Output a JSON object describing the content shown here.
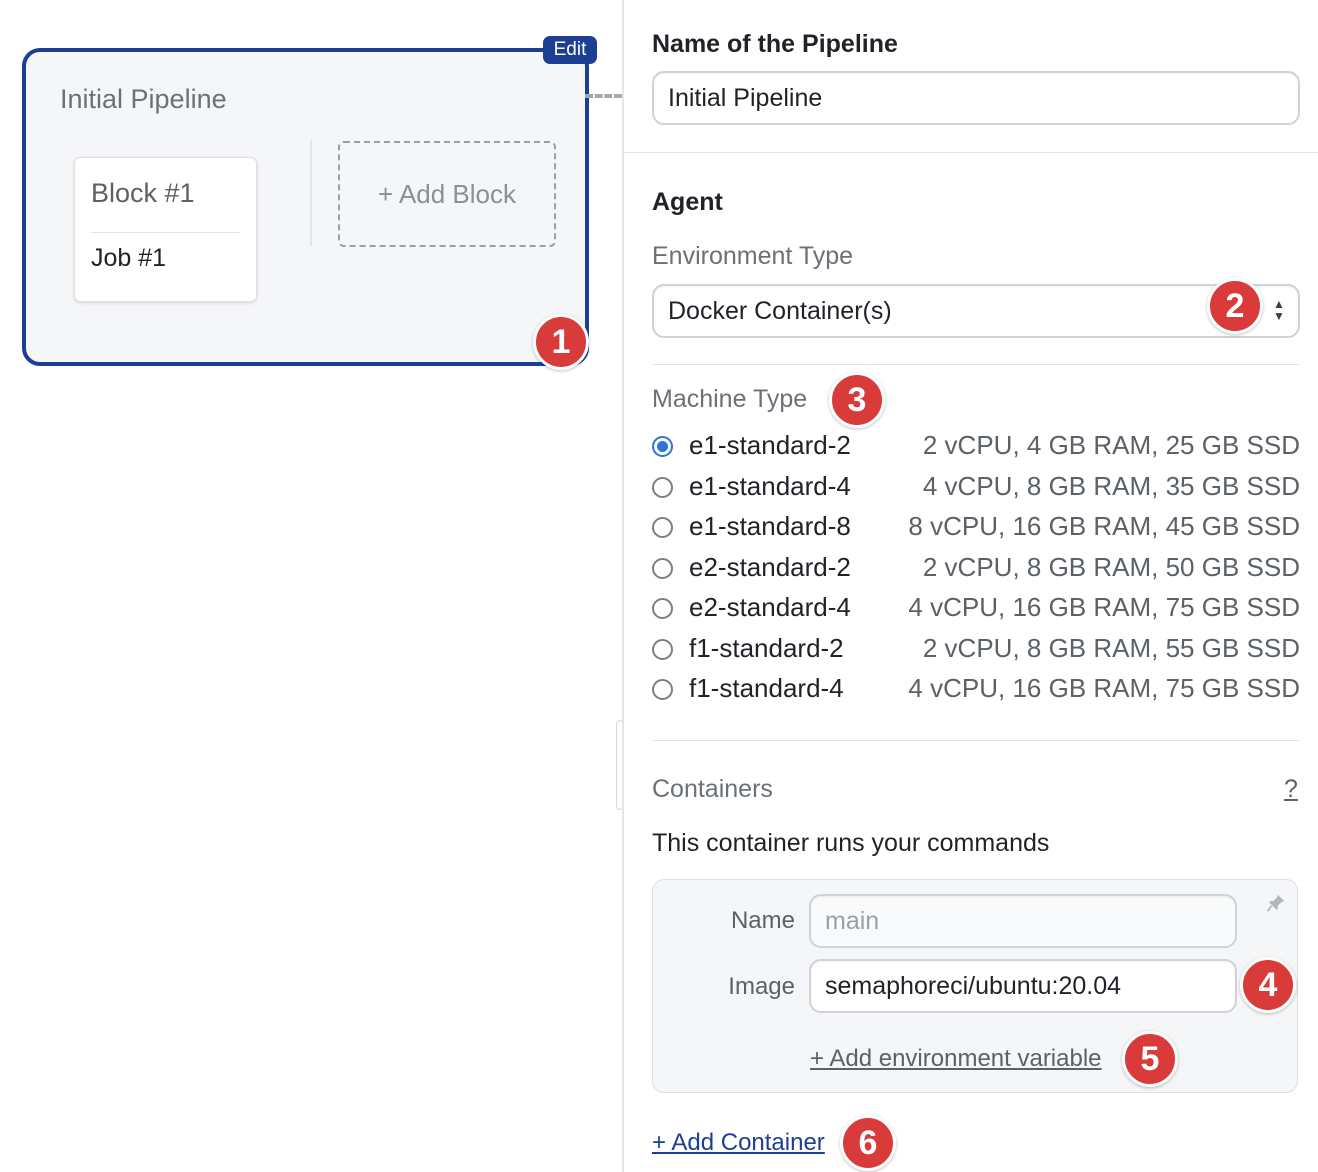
{
  "canvas": {
    "edit_label": "Edit",
    "pipeline_name": "Initial Pipeline",
    "block": {
      "title": "Block #1",
      "job": "Job #1"
    },
    "add_block_label": "+ Add Block"
  },
  "badges": [
    "1",
    "2",
    "3",
    "4",
    "5",
    "6"
  ],
  "panel": {
    "pipeline_name_label": "Name of the Pipeline",
    "pipeline_name_value": "Initial Pipeline",
    "agent_heading": "Agent",
    "environment_type_label": "Environment Type",
    "environment_type_value": "Docker Container(s)",
    "machine_type_label": "Machine Type",
    "machine_types": [
      {
        "name": "e1-standard-2",
        "spec": "2 vCPU, 4 GB RAM, 25 GB SSD",
        "selected": true
      },
      {
        "name": "e1-standard-4",
        "spec": "4 vCPU, 8 GB RAM, 35 GB SSD",
        "selected": false
      },
      {
        "name": "e1-standard-8",
        "spec": "8 vCPU, 16 GB RAM, 45 GB SSD",
        "selected": false
      },
      {
        "name": "e2-standard-2",
        "spec": "2 vCPU, 8 GB RAM, 50 GB SSD",
        "selected": false
      },
      {
        "name": "e2-standard-4",
        "spec": "4 vCPU, 16 GB RAM, 75 GB SSD",
        "selected": false
      },
      {
        "name": "f1-standard-2",
        "spec": "2 vCPU, 8 GB RAM, 55 GB SSD",
        "selected": false
      },
      {
        "name": "f1-standard-4",
        "spec": "4 vCPU, 16 GB RAM, 75 GB SSD",
        "selected": false
      }
    ],
    "containers_label": "Containers",
    "help_label": "?",
    "containers_description": "This container runs your commands",
    "container": {
      "name_label": "Name",
      "name_placeholder": "main",
      "image_label": "Image",
      "image_value": "semaphoreci/ubuntu:20.04",
      "add_env_label": "+ Add environment variable"
    },
    "add_container_label": "+ Add Container"
  },
  "colors": {
    "accent": "#1c3f94",
    "badge": "#d93a3a",
    "radio_selected": "#2f73e0"
  }
}
